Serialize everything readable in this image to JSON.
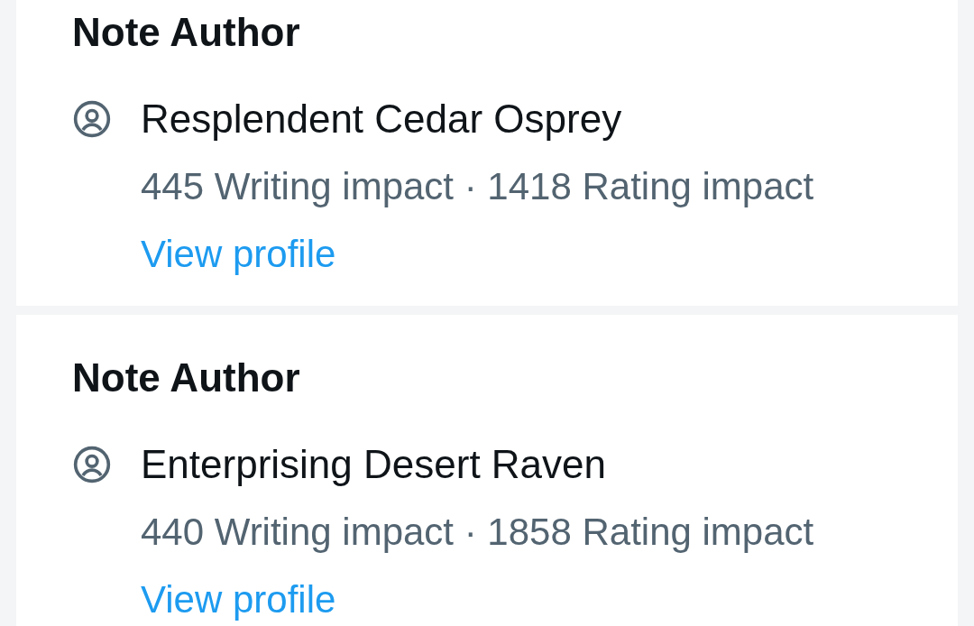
{
  "cards": [
    {
      "title": "Note Author",
      "name": "Resplendent Cedar Osprey",
      "stats": "445 Writing impact · 1418 Rating impact",
      "link": "View profile"
    },
    {
      "title": "Note Author",
      "name": "Enterprising Desert Raven",
      "stats": "440 Writing impact · 1858 Rating impact",
      "link": "View profile"
    }
  ]
}
